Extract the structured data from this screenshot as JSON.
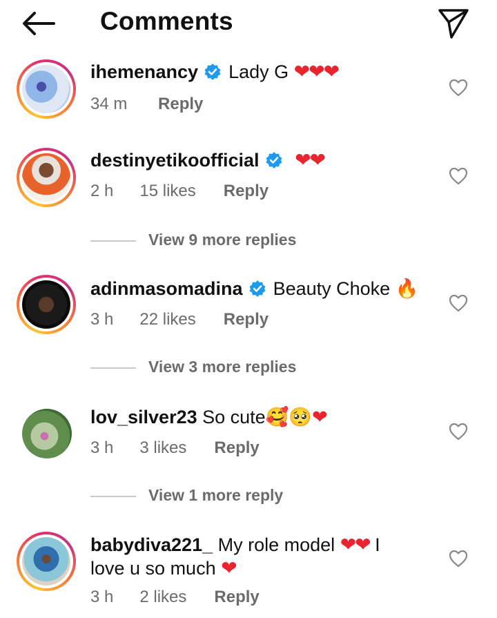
{
  "header": {
    "title": "Comments"
  },
  "comments": [
    {
      "username": "ihemenancy",
      "verified": true,
      "text": "Lady G",
      "emojis": "❤❤❤",
      "time": "34 m",
      "likes": "",
      "reply": "Reply"
    },
    {
      "username": "destinyetikoofficial",
      "verified": true,
      "text": "",
      "emojis": "❤❤",
      "time": "2 h",
      "likes": "15 likes",
      "reply": "Reply",
      "more_replies": "View 9 more replies"
    },
    {
      "username": "adinmasomadina",
      "verified": true,
      "text": "Beauty Choke",
      "emojis": "🔥",
      "time": "3 h",
      "likes": "22 likes",
      "reply": "Reply",
      "more_replies": "View 3 more replies"
    },
    {
      "username": "lov_silver23",
      "verified": false,
      "text": "So cute",
      "emojis": "🥰🥺❤",
      "time": "3 h",
      "likes": "3 likes",
      "reply": "Reply",
      "more_replies": "View 1 more reply"
    },
    {
      "username": "babydiva221_",
      "verified": false,
      "text": "My role model",
      "emojis": "❤❤",
      "text2": "I love u so much",
      "emojis2": "❤",
      "time": "3 h",
      "likes": "2 likes",
      "reply": "Reply"
    }
  ],
  "colors": {
    "accent_blue": "#1d9bf0",
    "heart_red": "#e8242f",
    "meta_gray": "#6b6b6b"
  }
}
